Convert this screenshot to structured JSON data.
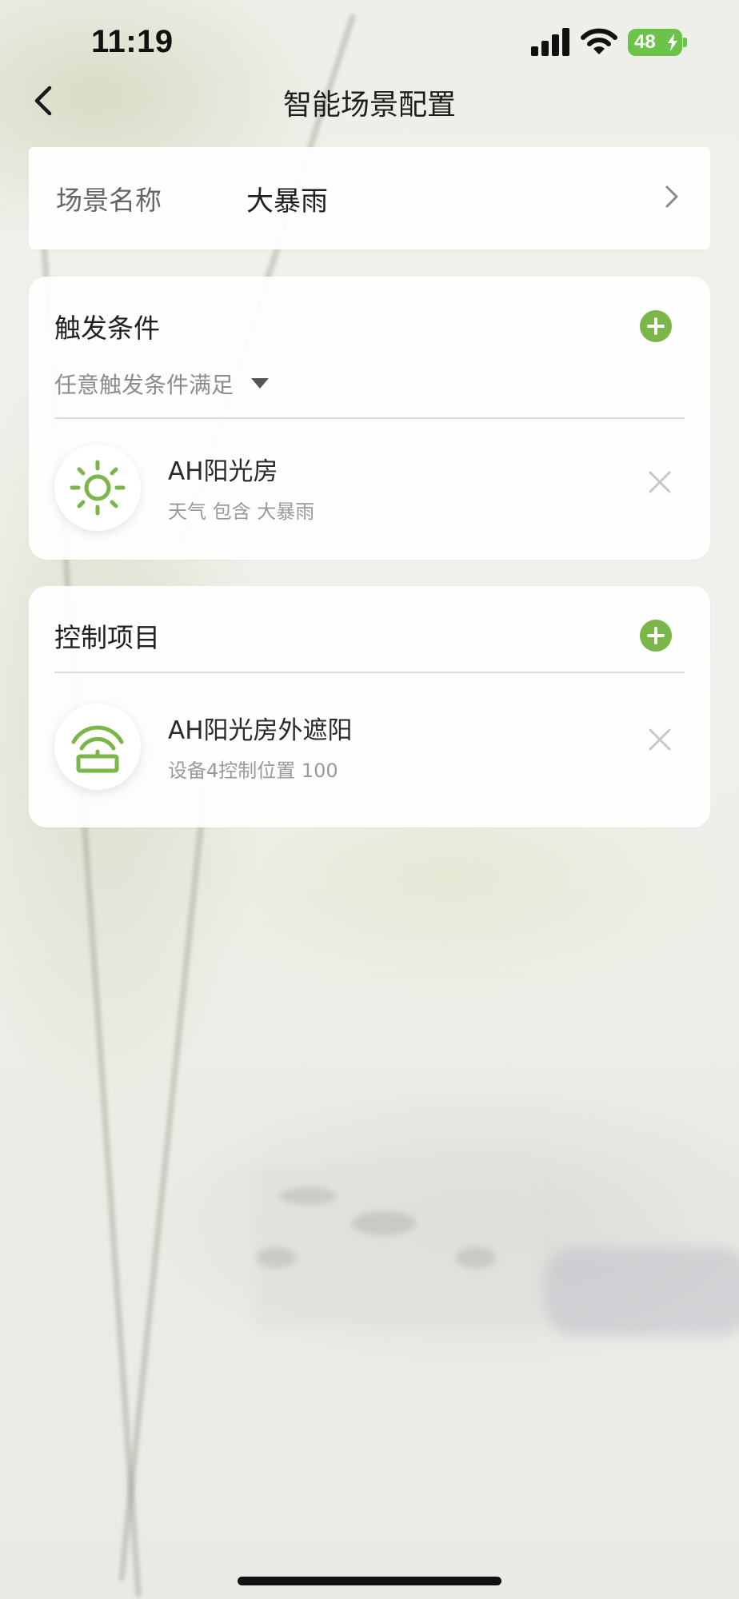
{
  "status_bar": {
    "time": "11:19",
    "battery": "48",
    "icons": [
      "signal-icon",
      "wifi-icon",
      "battery-icon",
      "charging-bolt-icon"
    ]
  },
  "nav": {
    "title": "智能场景配置",
    "back_icon": "chevron-left-icon"
  },
  "scene": {
    "label": "场景名称",
    "value": "大暴雨",
    "chevron_icon": "chevron-right-icon"
  },
  "trigger": {
    "title": "触发条件",
    "mode": "任意触发条件满足",
    "add_icon": "plus-icon",
    "items": [
      {
        "title": "AH阳光房",
        "subtitle": "天气 包含 大暴雨",
        "icon": "sun-icon",
        "remove_icon": "close-icon"
      }
    ]
  },
  "control": {
    "title": "控制项目",
    "add_icon": "plus-icon",
    "items": [
      {
        "title": "AH阳光房外遮阳",
        "subtitle": "设备4控制位置 100",
        "icon": "awning-icon",
        "remove_icon": "close-icon"
      }
    ]
  },
  "colors": {
    "accent": "#7ab648",
    "battery": "#6cc24a",
    "primary_text": "#1f1f1f",
    "secondary_text": "#9a9a9a"
  }
}
